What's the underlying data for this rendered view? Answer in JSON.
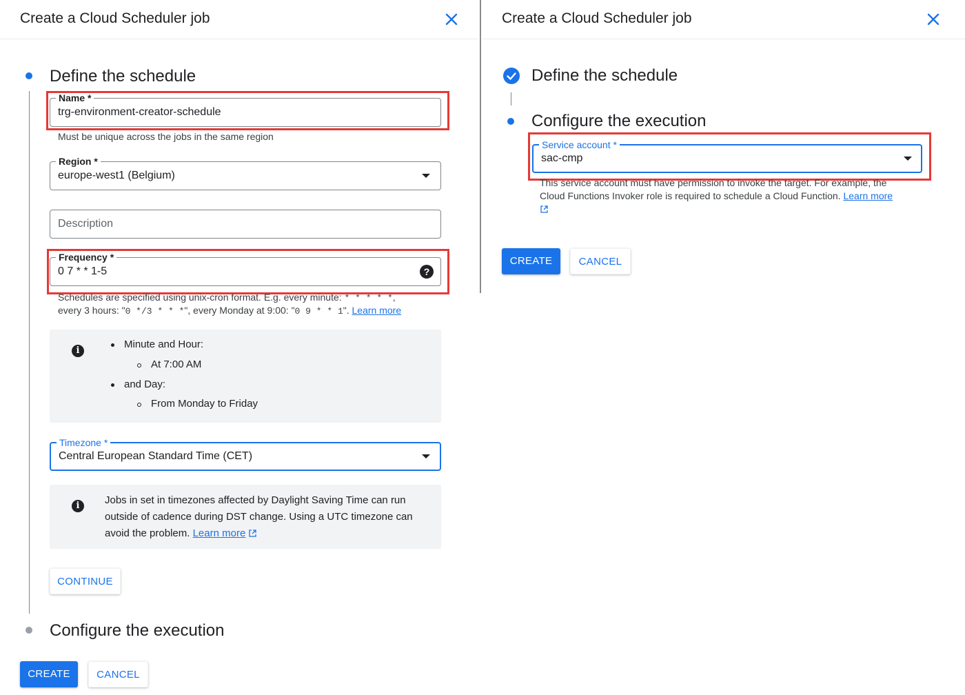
{
  "left_panel": {
    "title": "Create a Cloud Scheduler job",
    "step1": {
      "title": "Define the schedule",
      "name_field": {
        "label": "Name *",
        "value": "trg-environment-creator-schedule",
        "hint": "Must be unique across the jobs in the same region"
      },
      "region_field": {
        "label": "Region *",
        "value": "europe-west1 (Belgium)"
      },
      "description_field": {
        "placeholder": "Description"
      },
      "frequency_field": {
        "label": "Frequency *",
        "value": "0 7 * * 1-5",
        "hint_line1_text": "Schedules are specified using unix-cron format. E.g. every minute: ",
        "hint_line1_code": "* * * * *",
        "hint_line1_end": ",",
        "hint_line2_a": "every 3 hours: \"",
        "hint_line2_code1": "0 */3 * * *",
        "hint_line2_b": "\", every Monday at 9:00: \"",
        "hint_line2_code2": "0 9 * * 1",
        "hint_line2_c": "\". ",
        "hint_link": "Learn more"
      },
      "cron_info": {
        "items": [
          {
            "label": "Minute and Hour:",
            "sub": "At 7:00 AM"
          },
          {
            "label": "and Day:",
            "sub": "From Monday to Friday"
          }
        ]
      },
      "timezone_field": {
        "label": "Timezone *",
        "value": "Central European Standard Time (CET)"
      },
      "dst_info": {
        "line1": "Jobs in set in timezones affected by Daylight Saving Time can run",
        "line2": "outside of cadence during DST change. Using a UTC timezone can",
        "line3": "avoid the problem. ",
        "link": "Learn more"
      },
      "continue_label": "CONTINUE"
    },
    "step2": {
      "title": "Configure the execution"
    },
    "create_label": "CREATE",
    "cancel_label": "CANCEL"
  },
  "right_panel": {
    "title": "Create a Cloud Scheduler job",
    "step1": {
      "title": "Define the schedule",
      "status": "completed"
    },
    "step2": {
      "title": "Configure the execution",
      "service_account_field": {
        "label": "Service account *",
        "value": "sac-cmp",
        "hint_line1": "This service account must have permission to invoke the target. For example, the",
        "hint_line2": "Cloud Functions Invoker role is required to schedule a Cloud Function. ",
        "hint_link": "Learn more"
      }
    },
    "create_label": "CREATE",
    "cancel_label": "CANCEL"
  },
  "colors": {
    "accent": "#1a73e8",
    "highlight": "#e53935",
    "info_background": "#f1f3f4"
  },
  "icons": [
    "close-icon",
    "help-icon",
    "info-icon",
    "check-circle-icon",
    "external-link-icon",
    "dropdown-arrow-icon"
  ]
}
